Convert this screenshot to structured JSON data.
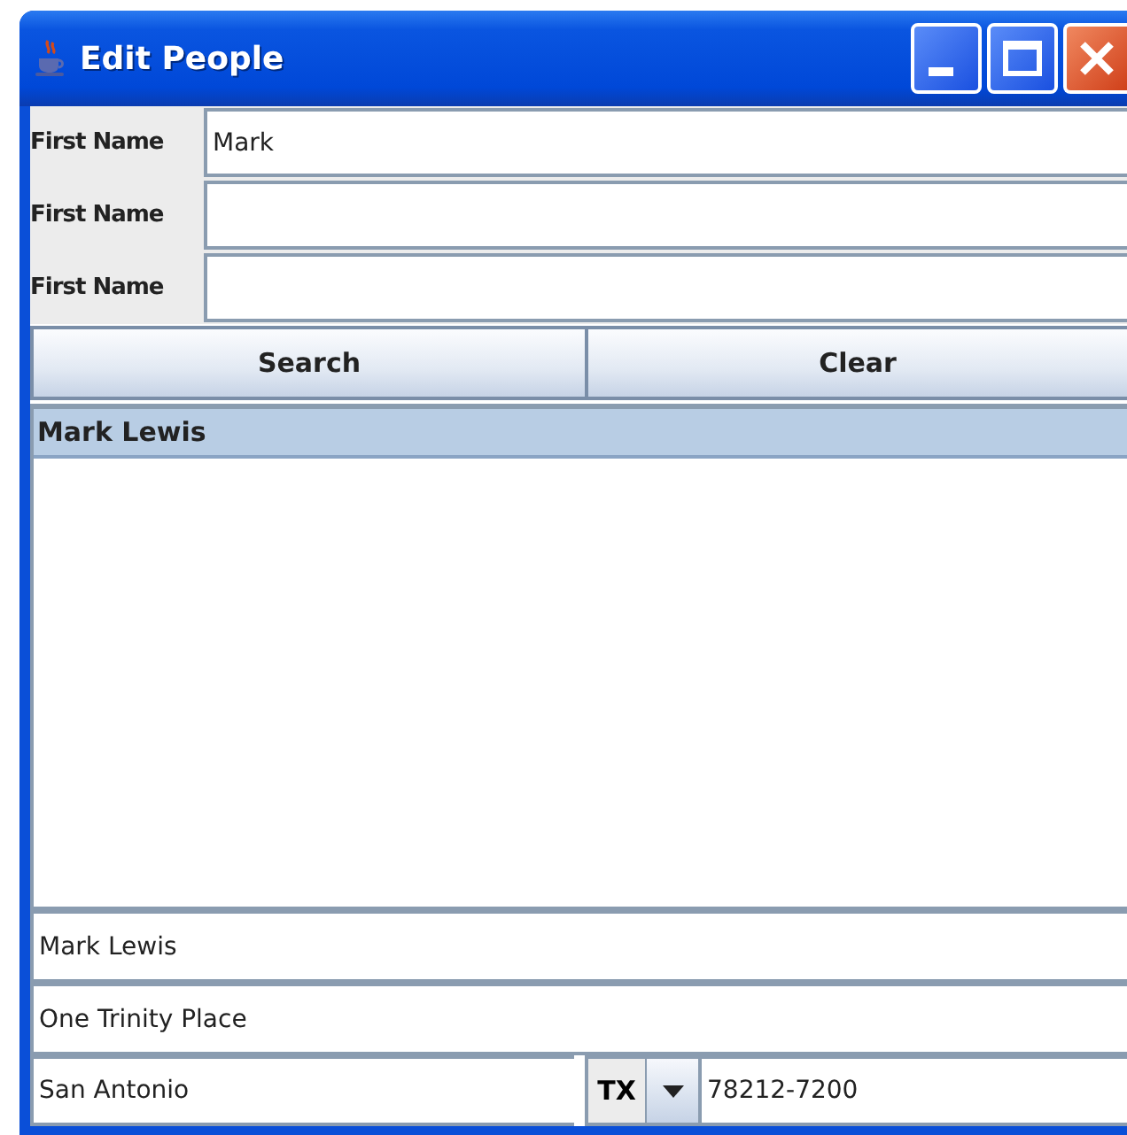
{
  "window": {
    "title": "Edit People"
  },
  "search_fields": [
    {
      "label": "First Name",
      "value": "Mark"
    },
    {
      "label": "First Name"
    },
    {
      "label": "First Name"
    }
  ],
  "buttons": [
    "Search",
    "Clear"
  ],
  "results": [
    {
      "name": "Mark Lewis",
      "selected": true
    }
  ],
  "details": {
    "name": "Mark Lewis",
    "street": "One Trinity Place",
    "city": "San Antonio",
    "state": "TX",
    "zip": "78212-7200"
  }
}
